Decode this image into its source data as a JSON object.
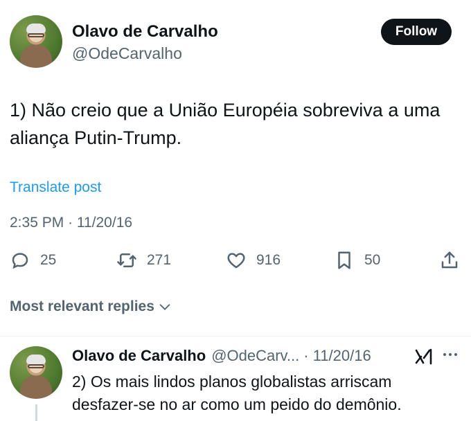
{
  "tweet": {
    "author_name": "Olavo de Carvalho",
    "author_handle": "@OdeCarvalho",
    "follow_label": "Follow",
    "text_line1": "1) Não creio que a União Européia sobreviva a uma",
    "text_line2": "aliança Putin-Trump.",
    "translate_label": "Translate post",
    "timestamp": "2:35 PM · 11/20/16",
    "stats": {
      "replies": "25",
      "reposts": "271",
      "likes": "916",
      "bookmarks": "50"
    }
  },
  "replies_section": {
    "sort_label": "Most relevant replies"
  },
  "reply": {
    "author_name": "Olavo de Carvalho",
    "author_handle": "@OdeCarv...",
    "date": "· 11/20/16",
    "text_line1": "2) Os mais lindos planos globalistas arriscam",
    "text_line2": "desfazer-se no ar como um peido do demônio."
  },
  "icons": {
    "reply": "speech-bubble-icon",
    "repost": "repost-arrows-icon",
    "like": "heart-icon",
    "bookmark": "bookmark-icon",
    "share": "share-upload-icon",
    "grok": "grok-icon",
    "more": "more-dots-icon",
    "chevron": "chevron-down-icon"
  }
}
